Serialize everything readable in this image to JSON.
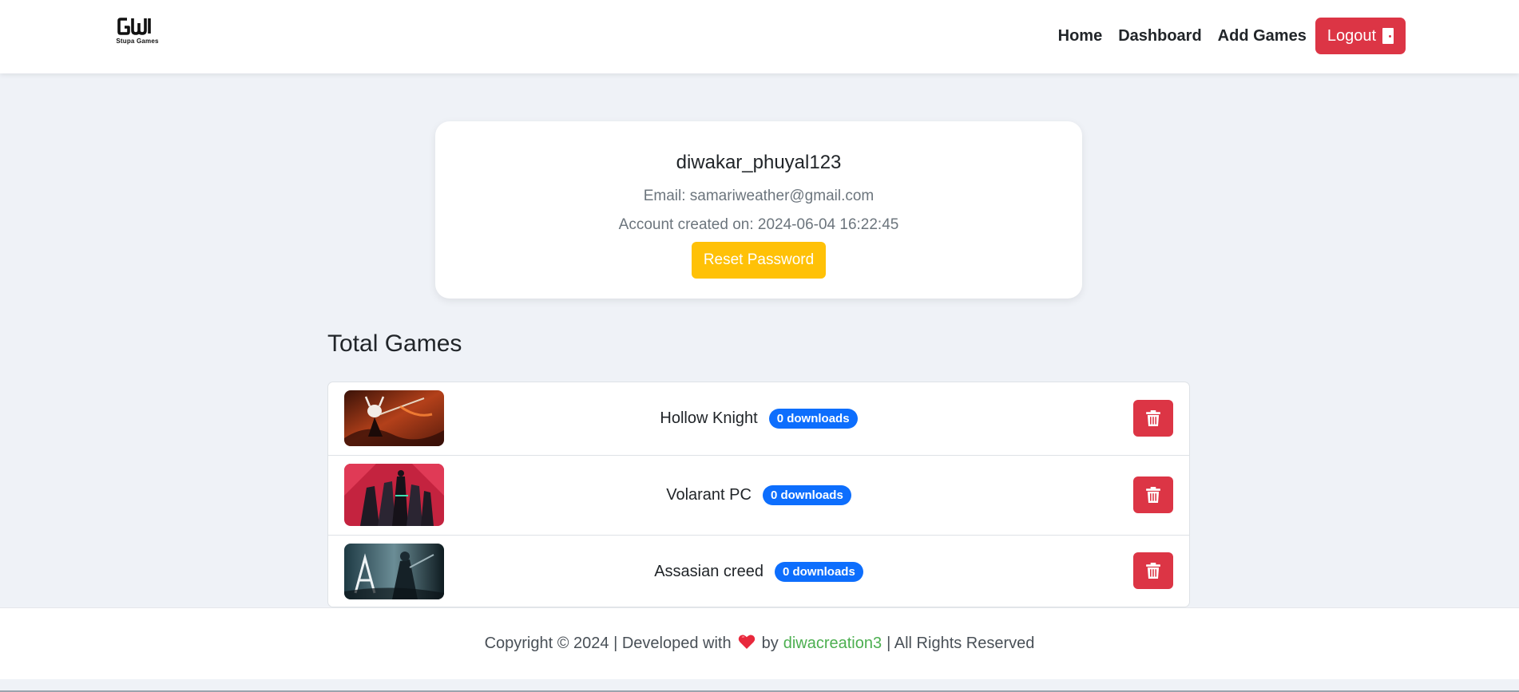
{
  "brand": {
    "logo_mark": "GW",
    "logo_text": "Stupa Games"
  },
  "nav": {
    "home": "Home",
    "dashboard": "Dashboard",
    "add_games": "Add Games",
    "logout": "Logout",
    "logout_icon": "door-icon"
  },
  "profile": {
    "username": "diwakar_phuyal123",
    "email": "Email: samariweather@gmail.com",
    "created": "Account created on: 2024-06-04 16:22:45",
    "reset_label": "Reset Password"
  },
  "games_section": {
    "title": "Total Games",
    "games": [
      {
        "name": "Hollow Knight",
        "downloads": "0 downloads",
        "delete_icon": "trash-icon"
      },
      {
        "name": "Volarant PC",
        "downloads": "0 downloads",
        "delete_icon": "trash-icon"
      },
      {
        "name": "Assasian creed",
        "downloads": "0 downloads",
        "delete_icon": "trash-icon"
      }
    ]
  },
  "footer": {
    "prefix": "Copyright © 2024 | Developed with",
    "by": "by",
    "author": "diwacreation3",
    "suffix": "| All Rights Reserved",
    "heart_icon": "heart-icon"
  },
  "colors": {
    "danger": "#dc3545",
    "warning": "#ffc107",
    "primary": "#0d6efd",
    "author_link": "#4caf50",
    "background": "#eff2f7"
  }
}
